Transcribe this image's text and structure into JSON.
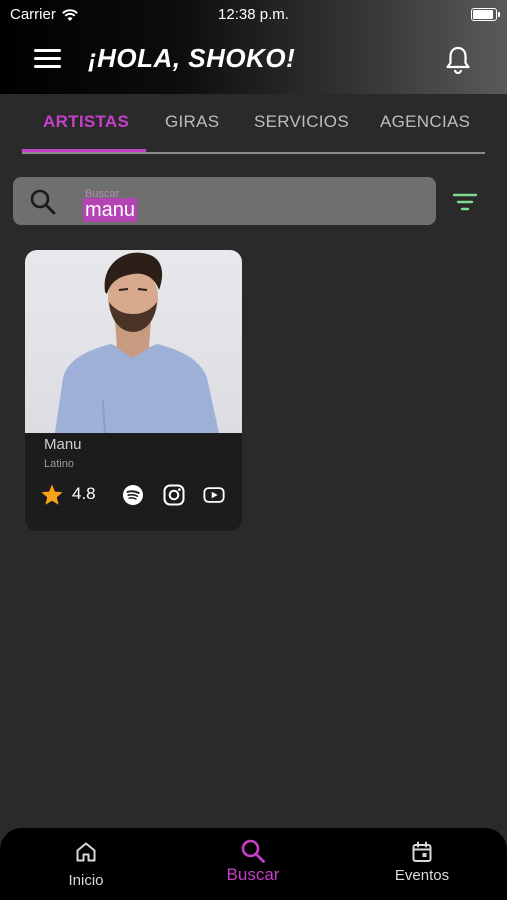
{
  "status_bar": {
    "carrier": "Carrier",
    "time": "12:38 p.m.",
    "battery_level": 1.0
  },
  "header": {
    "title": "¡HOLA, SHOKO!"
  },
  "tabs": [
    {
      "label": "ARTISTAS",
      "active": true
    },
    {
      "label": "GIRAS",
      "active": false
    },
    {
      "label": "SERVICIOS",
      "active": false
    },
    {
      "label": "AGENCIAS",
      "active": false
    }
  ],
  "search": {
    "placeholder": "Buscar",
    "value": "manu"
  },
  "results": [
    {
      "name": "Manu",
      "genre": "Latino",
      "rating": "4.8",
      "links": [
        "spotify-icon",
        "instagram-icon",
        "youtube-icon"
      ]
    }
  ],
  "bottom_nav": [
    {
      "label": "Inicio",
      "icon": "home-icon",
      "active": false
    },
    {
      "label": "Buscar",
      "icon": "search-icon",
      "active": true
    },
    {
      "label": "Eventos",
      "icon": "calendar-icon",
      "active": false
    }
  ],
  "colors": {
    "accent": "#c63fc9",
    "background": "#2a2a2a",
    "card": "#1c1c1c",
    "filter": "#7ddc8e",
    "star": "#f7a21b"
  }
}
